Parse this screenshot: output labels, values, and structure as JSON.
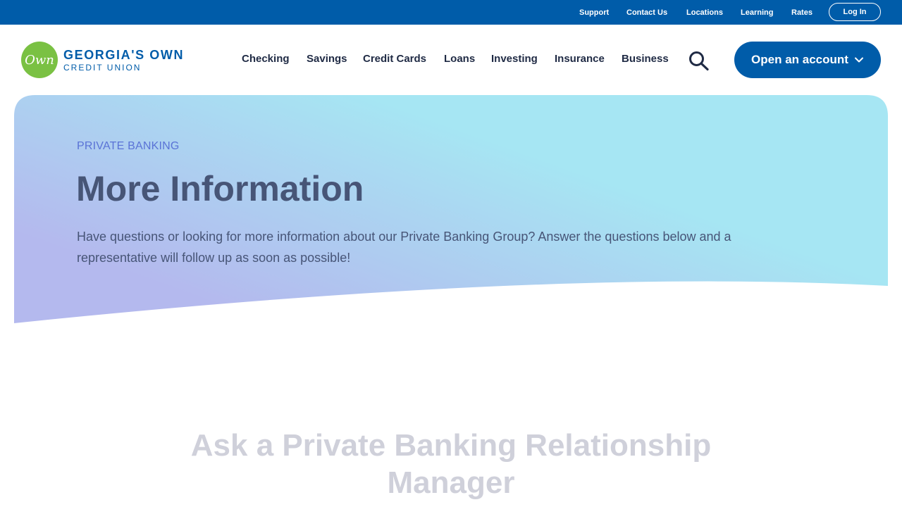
{
  "utility_nav": {
    "links": [
      "Support",
      "Contact Us",
      "Locations",
      "Learning",
      "Rates"
    ],
    "login_label": "Log In"
  },
  "header": {
    "logo": {
      "mark_text": "Own",
      "line1": "GEORGIA'S OWN",
      "line2": "CREDIT UNION"
    },
    "nav": [
      "Checking",
      "Savings",
      "Credit Cards",
      "Loans",
      "Investing",
      "Insurance",
      "Business"
    ],
    "search_icon": "search-icon",
    "open_account_label": "Open an account"
  },
  "hero": {
    "eyebrow": "PRIVATE BANKING",
    "title": "More Information",
    "description": "Have questions or looking for more information about our Private Banking Group? Answer the questions below and a representative will follow up as soon as possible!"
  },
  "section": {
    "title": "Ask a Private Banking Relationship Manager"
  },
  "colors": {
    "brand_blue": "#005ca9",
    "brand_green": "#7ac143",
    "hero_gradient_start": "#b4b9ee",
    "hero_gradient_end": "#a6e6f3"
  }
}
